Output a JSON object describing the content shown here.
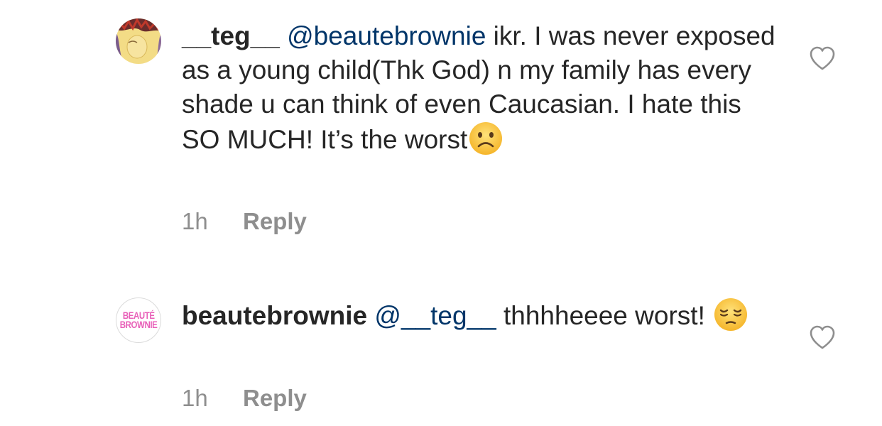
{
  "comments": [
    {
      "username": "__teg__",
      "mention": "@beautebrownie",
      "text": " ikr. I was never exposed as a young child(Thk God) n my family has every shade u can think of even Caucasian. I hate this SO MUCH! It’s the worst",
      "emoji": "frowning-face-emoji",
      "time": "1h",
      "reply_label": "Reply",
      "avatar": "user-avatar-photo"
    },
    {
      "username": "beautebrownie",
      "mention": "@__teg__",
      "text": " thhhheeee worst!",
      "emoji": "pensive-face-emoji",
      "time": "1h",
      "reply_label": "Reply",
      "avatar": {
        "line1": "BEAUTÉ",
        "line2": "BROWNIE",
        "color": "#e85fb8"
      }
    }
  ],
  "colors": {
    "text": "#262626",
    "mention": "#003569",
    "meta": "#8e8e8e",
    "icon": "#8e8e8e"
  },
  "icons": {
    "like": "heart-icon"
  }
}
